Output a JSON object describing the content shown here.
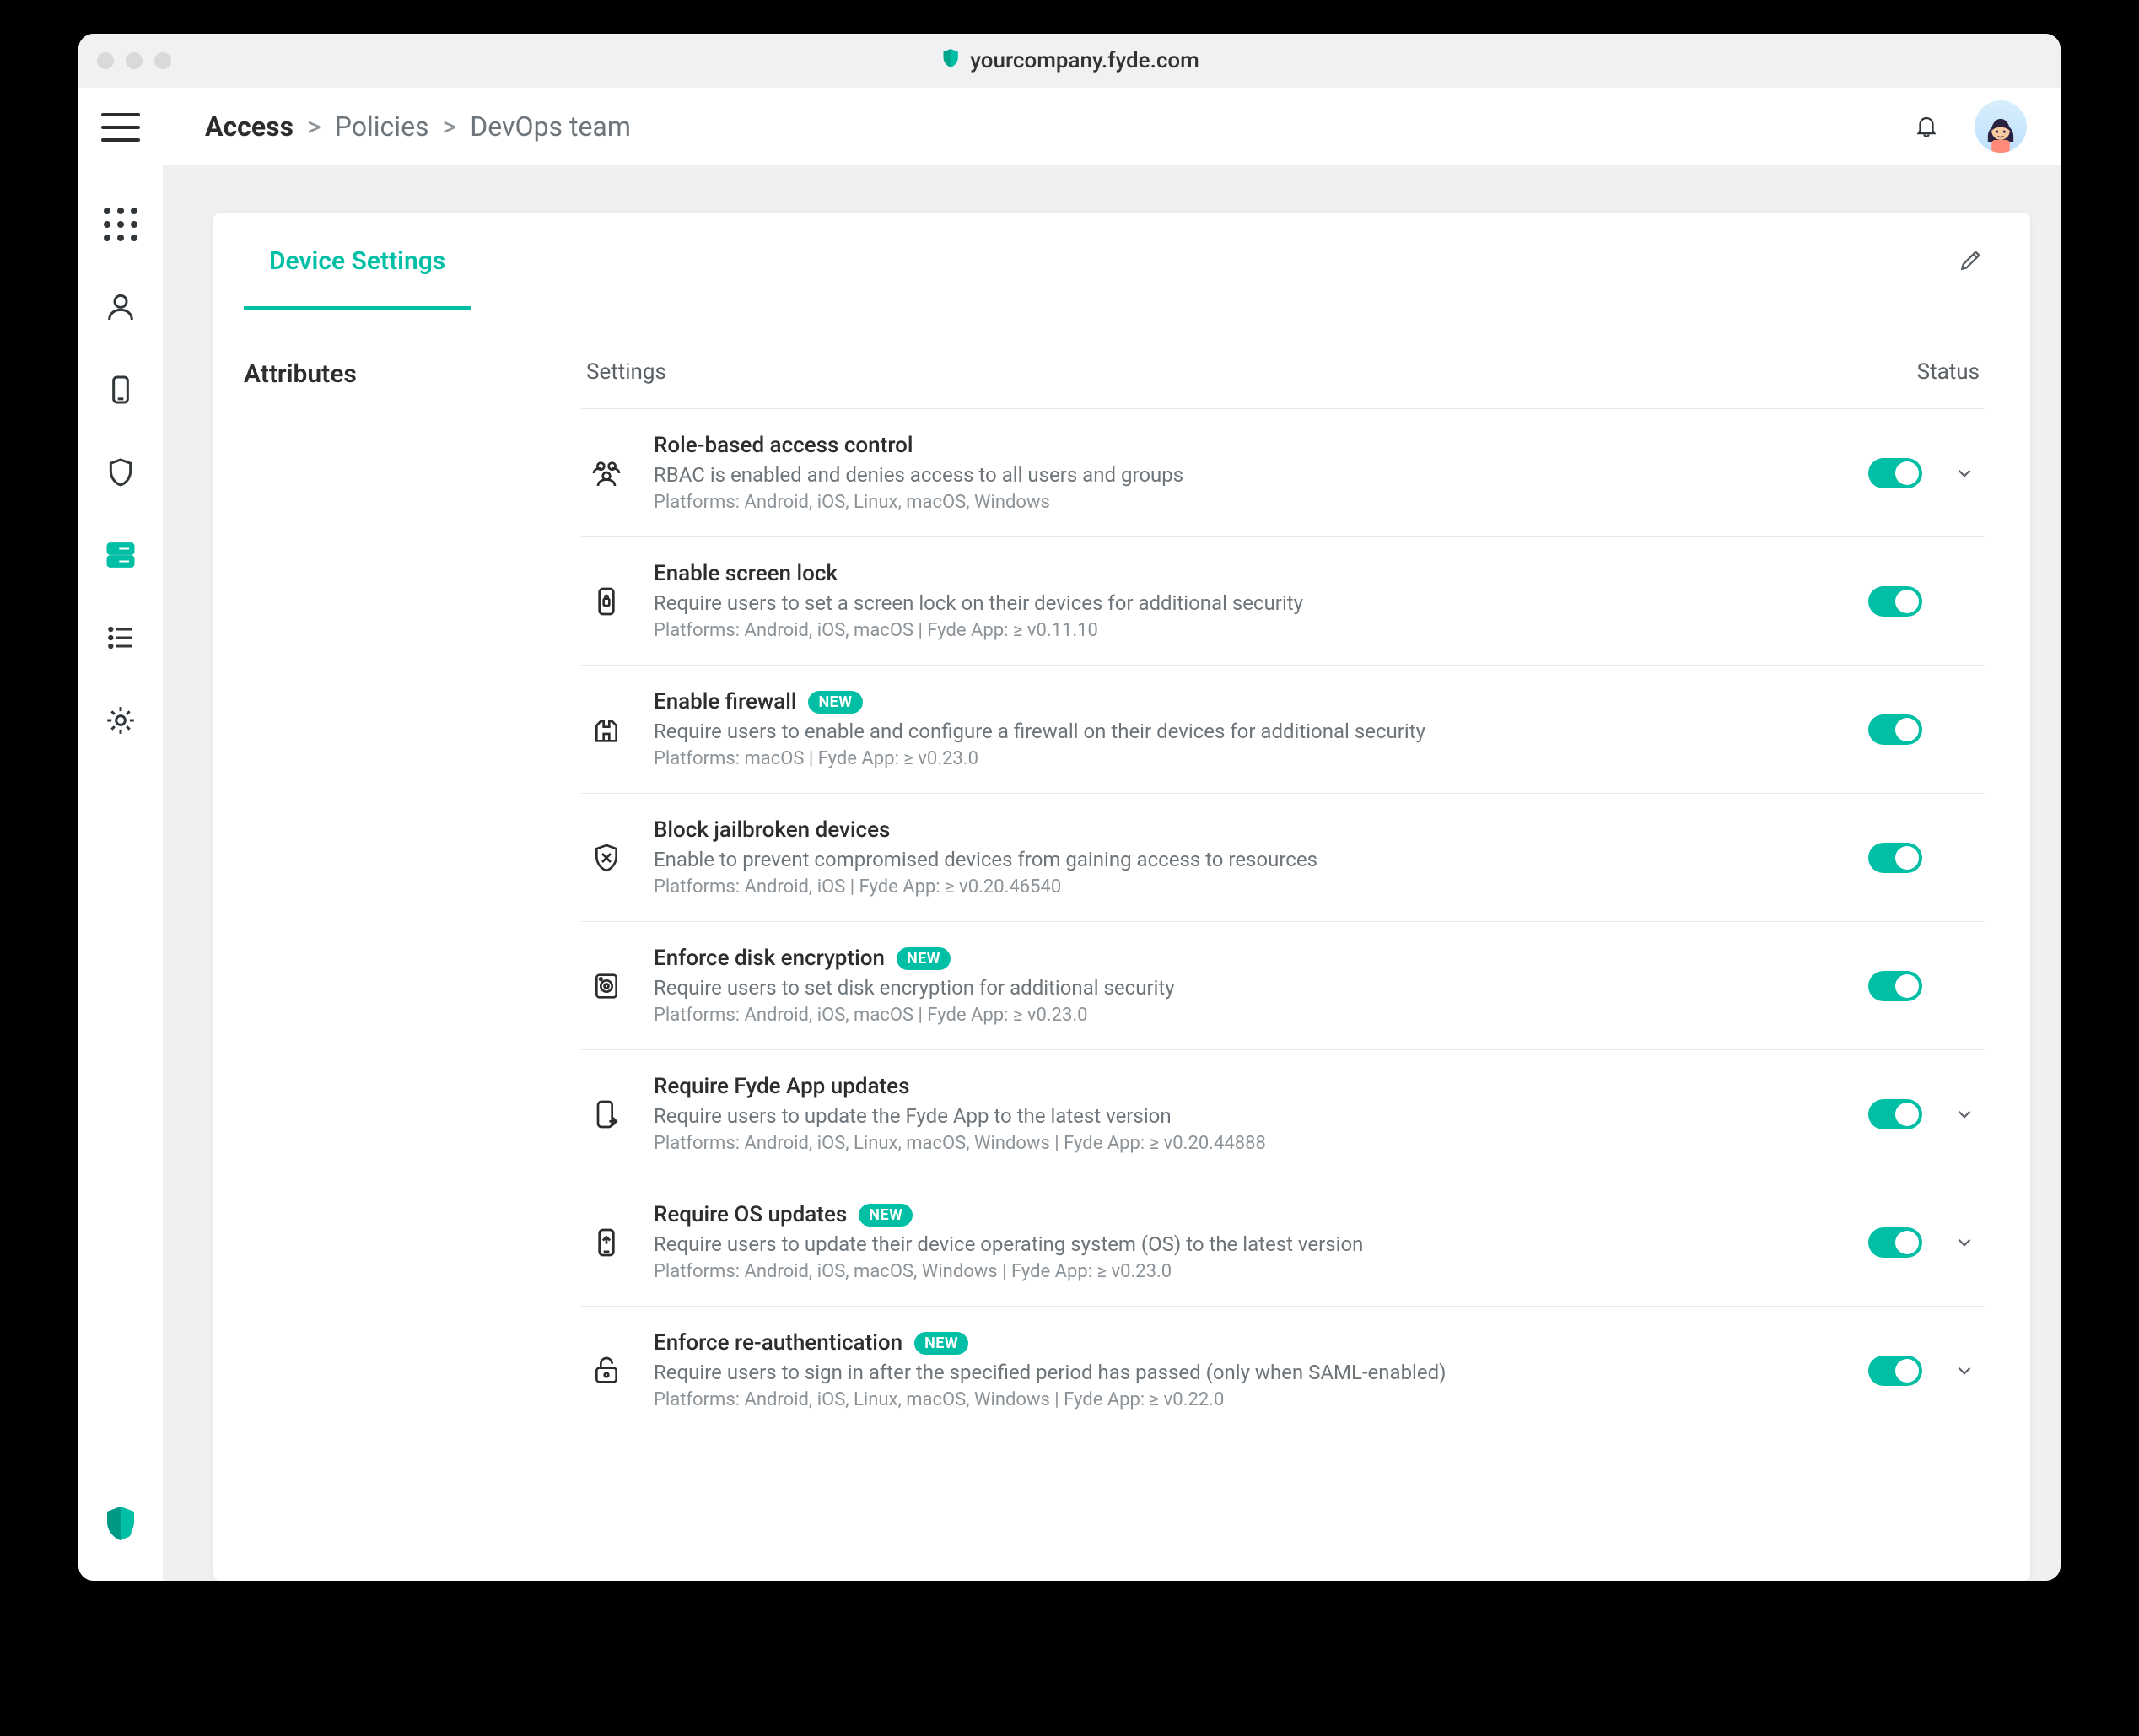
{
  "url": "yourcompany.fyde.com",
  "breadcrumbs": {
    "root": "Access",
    "level1": "Policies",
    "level2": "DevOps team"
  },
  "panel": {
    "tab_label": "Device Settings"
  },
  "section": {
    "side_title": "Attributes",
    "col_settings": "Settings",
    "col_status": "Status"
  },
  "badge_new": "NEW",
  "settings": [
    {
      "title": "Role-based access control",
      "desc": "RBAC is enabled and denies access to all users and groups",
      "platforms": "Platforms: Android, iOS, Linux, macOS, Windows",
      "new": false,
      "expandable": true
    },
    {
      "title": "Enable screen lock",
      "desc": "Require users to set a screen lock on their devices for additional security",
      "platforms": "Platforms: Android, iOS, macOS | Fyde App: ≥ v0.11.10",
      "new": false,
      "expandable": false
    },
    {
      "title": "Enable firewall",
      "desc": "Require users to enable and configure a firewall on their devices for additional security",
      "platforms": "Platforms: macOS | Fyde App: ≥ v0.23.0",
      "new": true,
      "expandable": false
    },
    {
      "title": "Block jailbroken devices",
      "desc": "Enable to prevent compromised devices from gaining access to resources",
      "platforms": "Platforms: Android, iOS | Fyde App: ≥ v0.20.46540",
      "new": false,
      "expandable": false
    },
    {
      "title": "Enforce disk encryption",
      "desc": "Require users to set disk encryption for additional security",
      "platforms": "Platforms: Android, iOS, macOS | Fyde App: ≥ v0.23.0",
      "new": true,
      "expandable": false
    },
    {
      "title": "Require Fyde App updates",
      "desc": "Require users to update the Fyde App to the latest version",
      "platforms": "Platforms: Android, iOS, Linux, macOS, Windows | Fyde App: ≥ v0.20.44888",
      "new": false,
      "expandable": true
    },
    {
      "title": "Require OS updates",
      "desc": "Require users to update their device operating system (OS) to the latest version",
      "platforms": "Platforms: Android, iOS, macOS, Windows | Fyde App: ≥ v0.23.0",
      "new": true,
      "expandable": true
    },
    {
      "title": "Enforce re-authentication",
      "desc": "Require users to sign in after the specified period has passed (only when SAML-enabled)",
      "platforms": "Platforms: Android, iOS, Linux, macOS, Windows | Fyde App: ≥ v0.22.0",
      "new": true,
      "expandable": true
    }
  ]
}
